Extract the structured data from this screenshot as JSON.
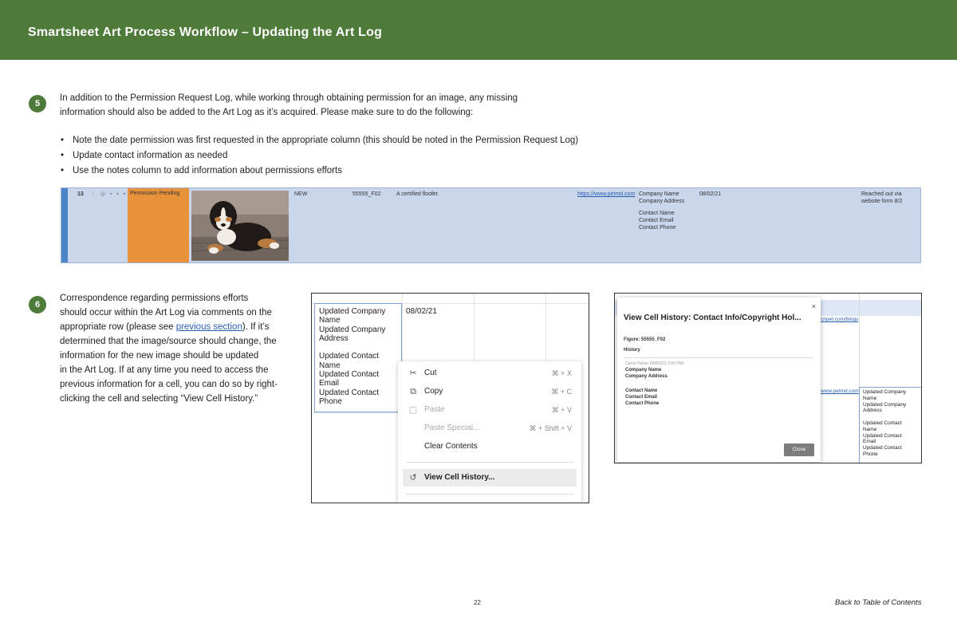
{
  "header": {
    "title": "Smartsheet Art Process Workflow – Updating the Art Log",
    "color": "#4e7a3a"
  },
  "step5": {
    "badge": "5",
    "line1": "In addition to the Permission Request Log, while working through obtaining permission for an image, any missing",
    "line2": "information should also be added to the Art Log as it’s acquired. Please make sure to do the following:",
    "bullets": [
      "Note the date permission was first requested in the appropriate column (this should be noted in the Permission Request Log)",
      "Update contact information as needed",
      "Use the notes column to add information about permissions efforts"
    ]
  },
  "art_log_row": {
    "row_number": "13",
    "status": "Permission Pending",
    "status_color": "#e8923c",
    "new_label": "NEW",
    "figure": "55555_F02",
    "description": "A certified floofer.",
    "url": "https://www.petmd.com",
    "contact_company": "Company Name\nCompany Address",
    "contact_person": "Contact Name\nContact Email\nContact Phone",
    "date": "08/02/21",
    "notes": "Reached out via\nwebsite form 8/2"
  },
  "step6": {
    "badge": "6",
    "lines": [
      "Correspondence regarding permissions efforts",
      "should occur within the Art Log via comments on the",
      "determined that the image/source should change, the",
      "information for the new image should be updated",
      "in the Art Log. If at any time you need to access the",
      "previous information for a cell, you can do so by right-",
      "clicking the cell and selecting “View Cell History.”"
    ],
    "line3_before": "appropriate row (please see ",
    "line3_link": "previous section",
    "line3_after": "). If it’s"
  },
  "context_shot": {
    "cell_text": "Updated Company\nName\nUpdated Company\nAddress\n\nUpdated Contact\nName\nUpdated Contact\nEmail\nUpdated Contact\nPhone",
    "date": "08/02/21",
    "menu": [
      {
        "icon": "scissors-icon",
        "label": "Cut",
        "shortcut": "⌘ + X"
      },
      {
        "icon": "copy-icon",
        "label": "Copy",
        "shortcut": "⌘ + C"
      },
      {
        "icon": "paste-icon",
        "label": "Paste",
        "shortcut": "⌘ + V"
      },
      {
        "icon": "",
        "label": "Paste Special...",
        "shortcut": "⌘ + Shift + V"
      },
      {
        "icon": "",
        "label": "Clear Contents",
        "shortcut": ""
      },
      {
        "icon": "history-icon",
        "label": "View Cell History...",
        "shortcut": ""
      }
    ]
  },
  "history_shot": {
    "title": "View Cell History: Contact Info/Copyright Hol...",
    "close_x": "×",
    "figure": "Figure: 55555_F02",
    "history_label": "History",
    "entry_who": "Carrie Pelzer (08/02/21 3:55 PM)",
    "entry_company": "Company Name\nCompany Address",
    "entry_contact": "Contact Name\nContact Email\nContact Phone",
    "close_button": "Close",
    "bg_link_top": "chpet.com/blogs",
    "bg_link_mid": "www.petmd.com",
    "bg_cell": "Updated Company\nName\nUpdated Company\nAddress\n\nUpdated Contact\nName\nUpdated Contact\nEmail\nUpdated Contact\nPhone"
  },
  "footer": {
    "page_number": "22",
    "toc": "Back to Table of Contents"
  }
}
